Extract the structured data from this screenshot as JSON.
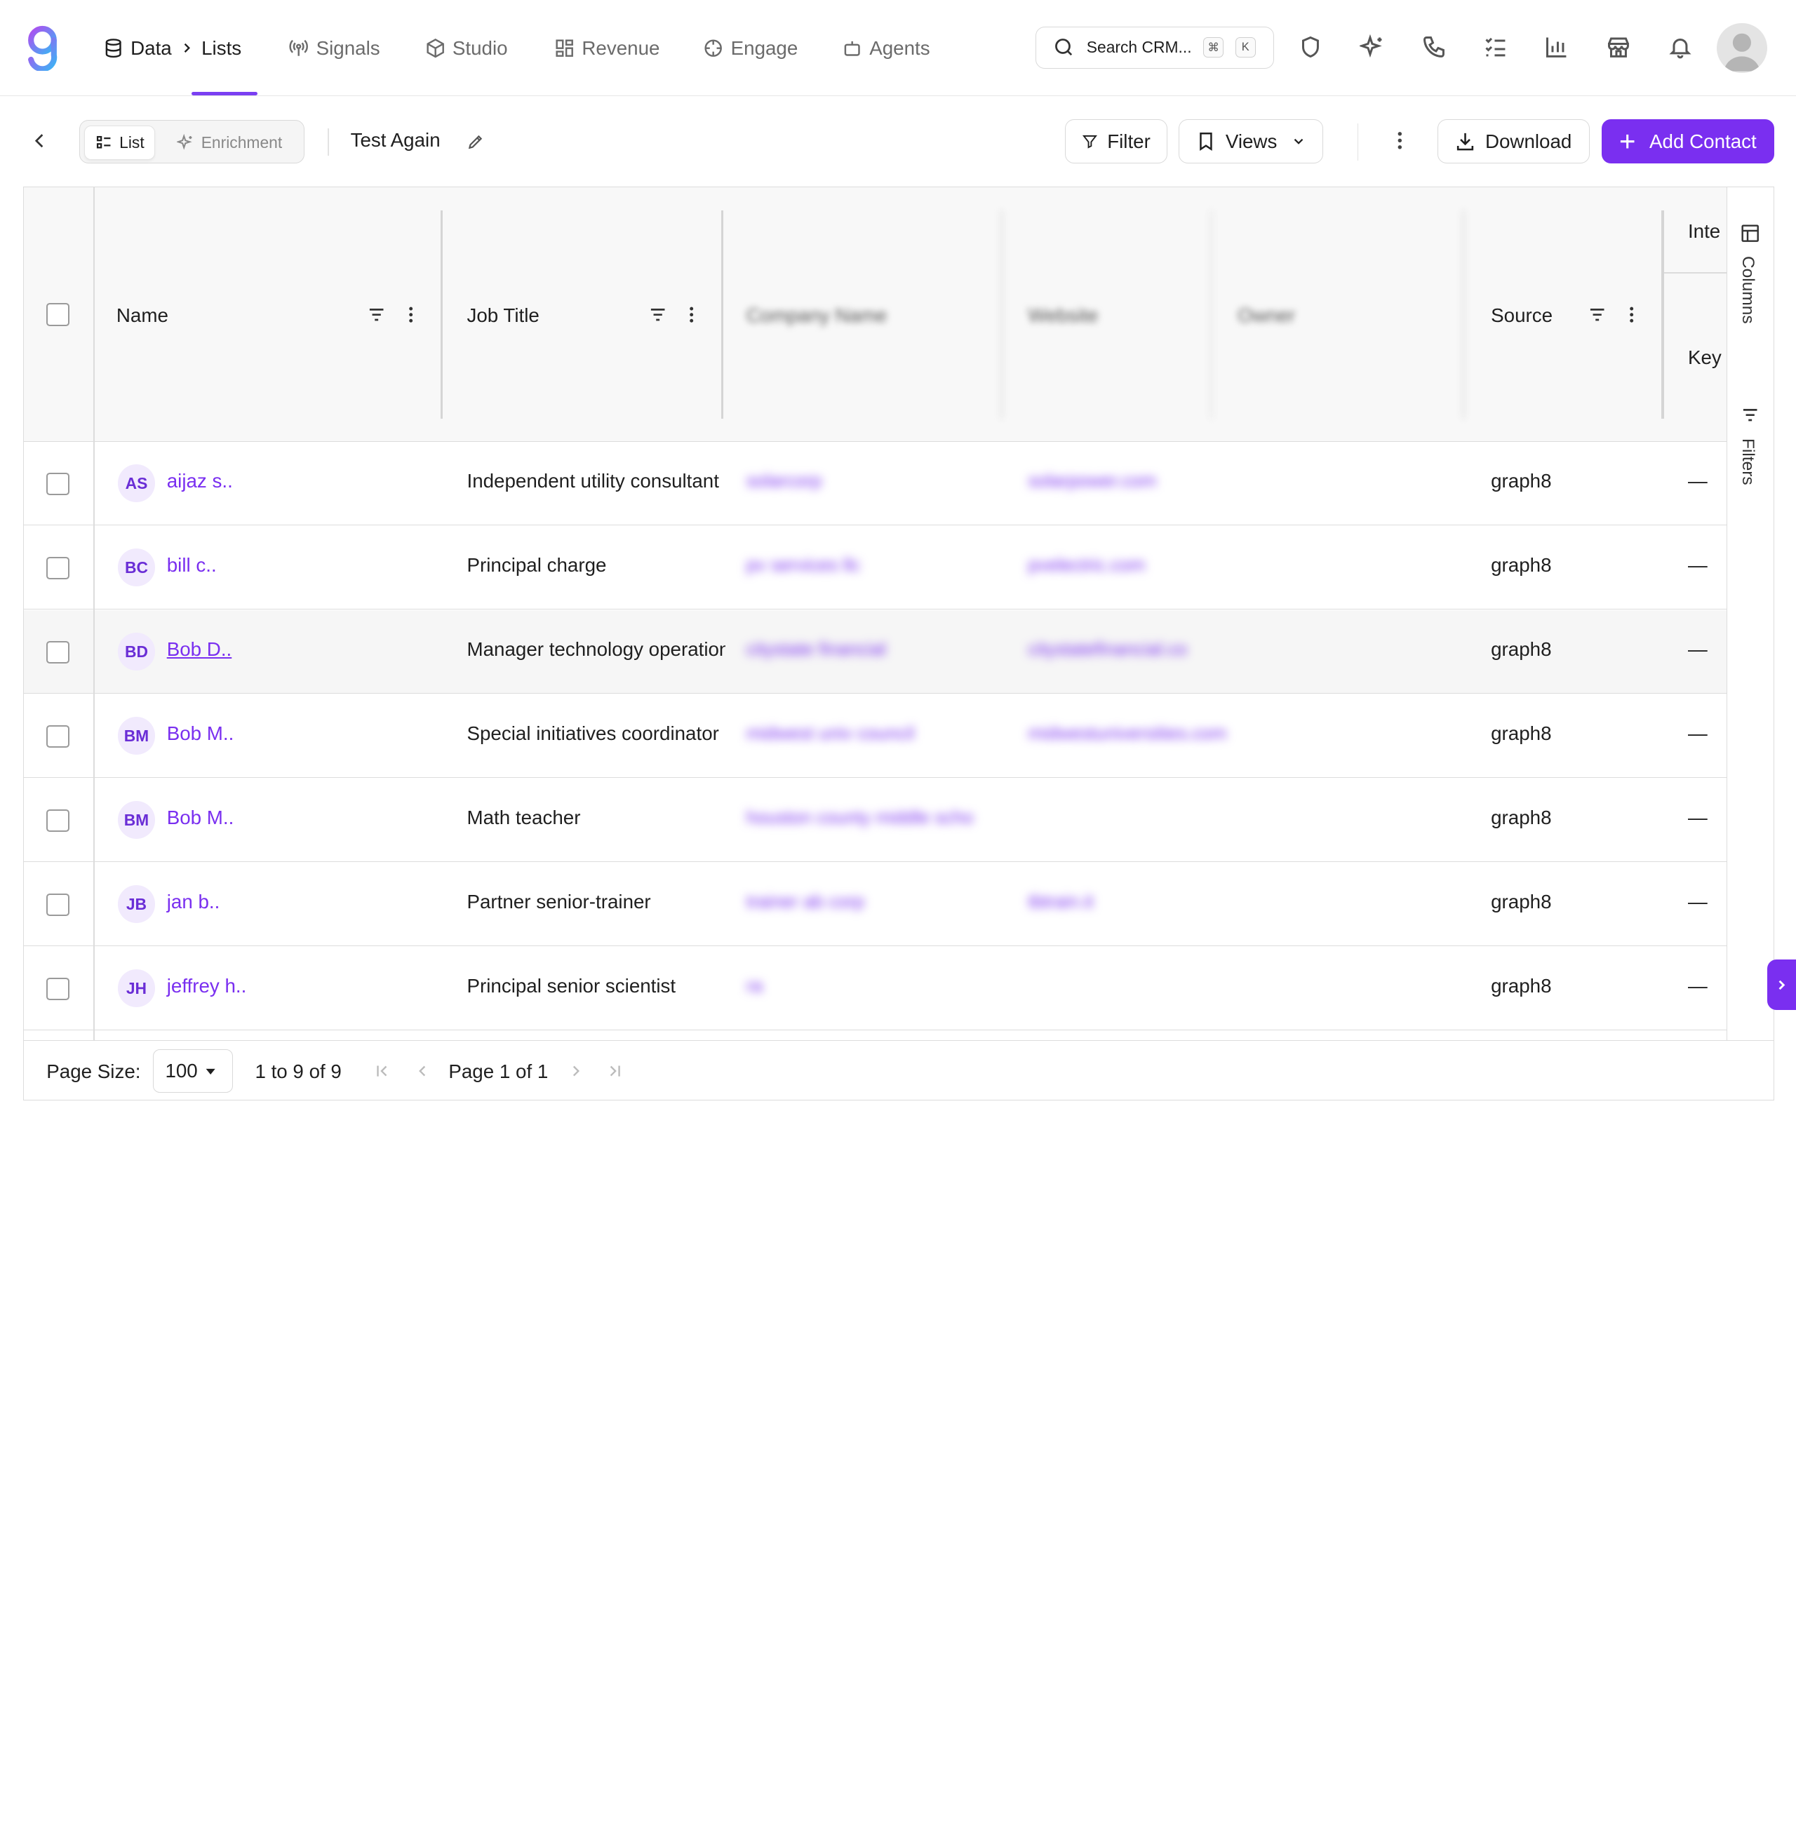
{
  "nav": {
    "crumb_data": "Data",
    "crumb_lists": "Lists",
    "signals": "Signals",
    "studio": "Studio",
    "revenue": "Revenue",
    "engage": "Engage",
    "agents": "Agents"
  },
  "search": {
    "placeholder": "Search CRM...",
    "kbd_cmd": "⌘",
    "kbd_k": "K"
  },
  "toolbar": {
    "tab_list": "List",
    "tab_enrichment": "Enrichment",
    "list_title": "Test Again",
    "filter": "Filter",
    "views": "Views",
    "download": "Download",
    "add_contact": "Add Contact"
  },
  "columns": {
    "name": "Name",
    "job_title": "Job Title",
    "company_blur": "Company Name",
    "website_blur": "Website",
    "owner_blur": "Owner",
    "source": "Source",
    "intent_top": "Inte",
    "intent_bottom": "Key"
  },
  "rows": [
    {
      "initials": "AS",
      "name": "aijaz s..",
      "job": "Independent utility consultant",
      "company": "solarcorp",
      "website": "solarpower.com",
      "source": "graph8",
      "intent": "—"
    },
    {
      "initials": "BC",
      "name": "bill c..",
      "job": "Principal charge",
      "company": "pv services llc",
      "website": "pvelectric.com",
      "source": "graph8",
      "intent": "—"
    },
    {
      "initials": "BD",
      "name": "Bob D..",
      "job": "Manager technology operations",
      "company": "citystate financial",
      "website": "citystatefinancial.co",
      "source": "graph8",
      "intent": "—"
    },
    {
      "initials": "BM",
      "name": "Bob M..",
      "job": "Special initiatives coordinator",
      "company": "midwest univ council",
      "website": "midwestuniversities.com",
      "source": "graph8",
      "intent": "—"
    },
    {
      "initials": "BM",
      "name": "Bob M..",
      "job": "Math teacher",
      "company": "houston county middle scho",
      "website": "",
      "source": "graph8",
      "intent": "—"
    },
    {
      "initials": "JB",
      "name": "jan b..",
      "job": "Partner senior-trainer",
      "company": "trainer ab corp",
      "website": "tbtrain.it",
      "source": "graph8",
      "intent": "—"
    },
    {
      "initials": "JH",
      "name": "jeffrey h..",
      "job": "Principal senior scientist",
      "company": "ra",
      "website": "",
      "source": "graph8",
      "intent": "—"
    }
  ],
  "side": {
    "columns": "Columns",
    "filters": "Filters"
  },
  "footer": {
    "page_size_label": "Page Size:",
    "page_size": "100",
    "range": "1 to 9 of 9",
    "page_info": "Page 1 of 1"
  },
  "colors": {
    "accent": "#7a2ff0",
    "initials_bg": "#f1eafd"
  }
}
